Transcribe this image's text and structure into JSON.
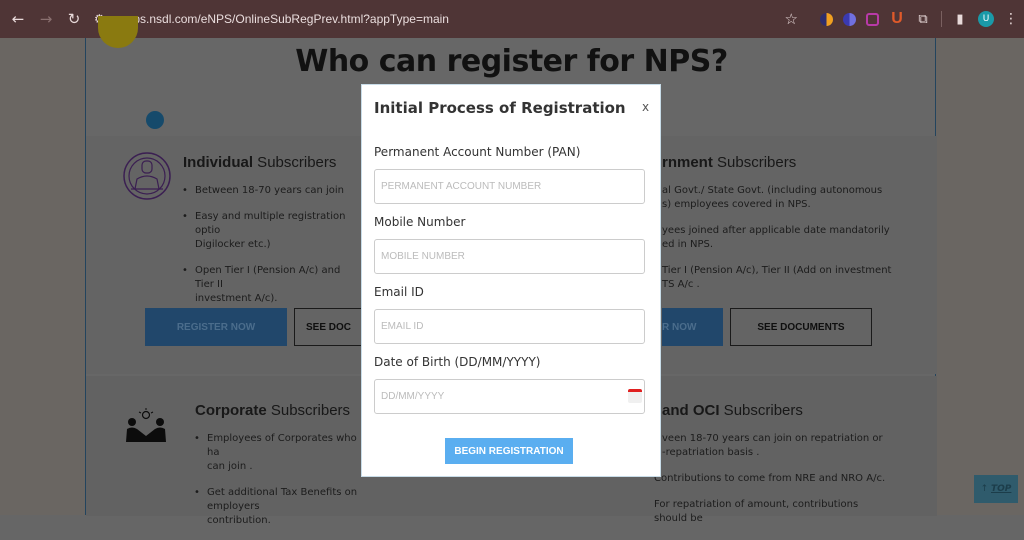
{
  "browser": {
    "url": "enps.nsdl.com/eNPS/OnlineSubRegPrev.html?appType=main",
    "back_icon": "←",
    "forward_icon": "→",
    "reload_icon": "↻",
    "site_info_icon": "⚙",
    "bookmark_icon": "☆",
    "extensions_icon": "⧉",
    "sidepanel_icon": "▮",
    "profile_initial": "U",
    "menu_icon": "⋮",
    "ext_letter": "U"
  },
  "page": {
    "headline": "Who can register for NPS?",
    "cards": [
      {
        "title_bold": "Individual",
        "title_rest": " Subscribers",
        "bullets": [
          "Between 18-70 years can join",
          "Easy and multiple registration optio",
          "Open Tier I (Pension A/c) and Tier II"
        ],
        "bullet_continuations": [
          "",
          "Digilocker etc.)",
          "investment A/c)."
        ],
        "register_label": "REGISTER NOW",
        "documents_label": "SEE DOC"
      },
      {
        "title_bold": "rnment",
        "title_rest": " Subscribers",
        "bullets": [
          "al Govt./ State Govt. (including autonomous",
          "yees joined after applicable date mandatorily",
          "Tier I (Pension A/c), Tier II (Add on investment"
        ],
        "bullet_continuations": [
          "s) employees covered in NPS.",
          "ed in NPS.",
          "TS A/c ."
        ],
        "register_label": "R NOW",
        "documents_label": "SEE DOCUMENTS"
      },
      {
        "title_bold": "Corporate",
        "title_rest": " Subscribers",
        "bullets": [
          "Employees of Corporates who ha",
          "Get additional Tax Benefits on employers"
        ],
        "bullet_continuations": [
          "can join .",
          "contribution."
        ]
      },
      {
        "title_bold": "and OCI",
        "title_rest": " Subscribers",
        "bullets": [
          "veen 18-70 years can join on repatriation or",
          "Contributions to come from NRE and NRO A/c.",
          "For repatriation of amount, contributions should be"
        ],
        "bullet_continuations": [
          "-repatriation basis .",
          "",
          ""
        ]
      }
    ],
    "top_link": "TOP",
    "top_arrow": "↑"
  },
  "modal": {
    "title": "Initial Process of Registration",
    "close_label": "x",
    "fields": [
      {
        "label": "Permanent Account Number (PAN)",
        "placeholder": "PERMANENT ACCOUNT NUMBER",
        "value": ""
      },
      {
        "label": "Mobile Number",
        "placeholder": "MOBILE NUMBER",
        "value": ""
      },
      {
        "label": "Email ID",
        "placeholder": "EMAIL ID",
        "value": ""
      },
      {
        "label": "Date of Birth (DD/MM/YYYY)",
        "placeholder": "DD/MM/YYYY",
        "value": ""
      }
    ],
    "submit_label": "BEGIN REGISTRATION"
  },
  "colors": {
    "accent": "#5aaef0",
    "chrome_bg": "#4f3536"
  }
}
